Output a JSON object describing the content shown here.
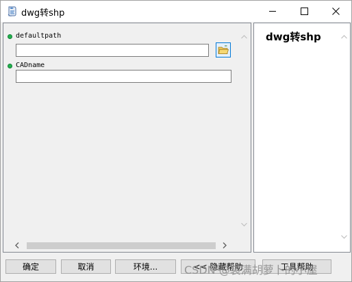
{
  "window": {
    "title": "dwg转shp"
  },
  "titlebar": {
    "minimize": "minimize",
    "maximize": "maximize",
    "close": "close"
  },
  "parameters": [
    {
      "label": "defaultpath",
      "value": "",
      "has_browse": true,
      "status_color": "#22b14c"
    },
    {
      "label": "CADname",
      "value": "",
      "has_browse": false,
      "status_color": "#22b14c"
    }
  ],
  "help": {
    "title": "dwg转shp"
  },
  "buttons": {
    "ok": "确定",
    "cancel": "取消",
    "environments": "环境...",
    "hide_help": "<< 隐藏帮助",
    "tool_help": "工具帮助"
  },
  "watermark": "CSDN @装满胡萝卜的小屋",
  "colors": {
    "accent": "#0078d7",
    "status": "#22b14c"
  }
}
